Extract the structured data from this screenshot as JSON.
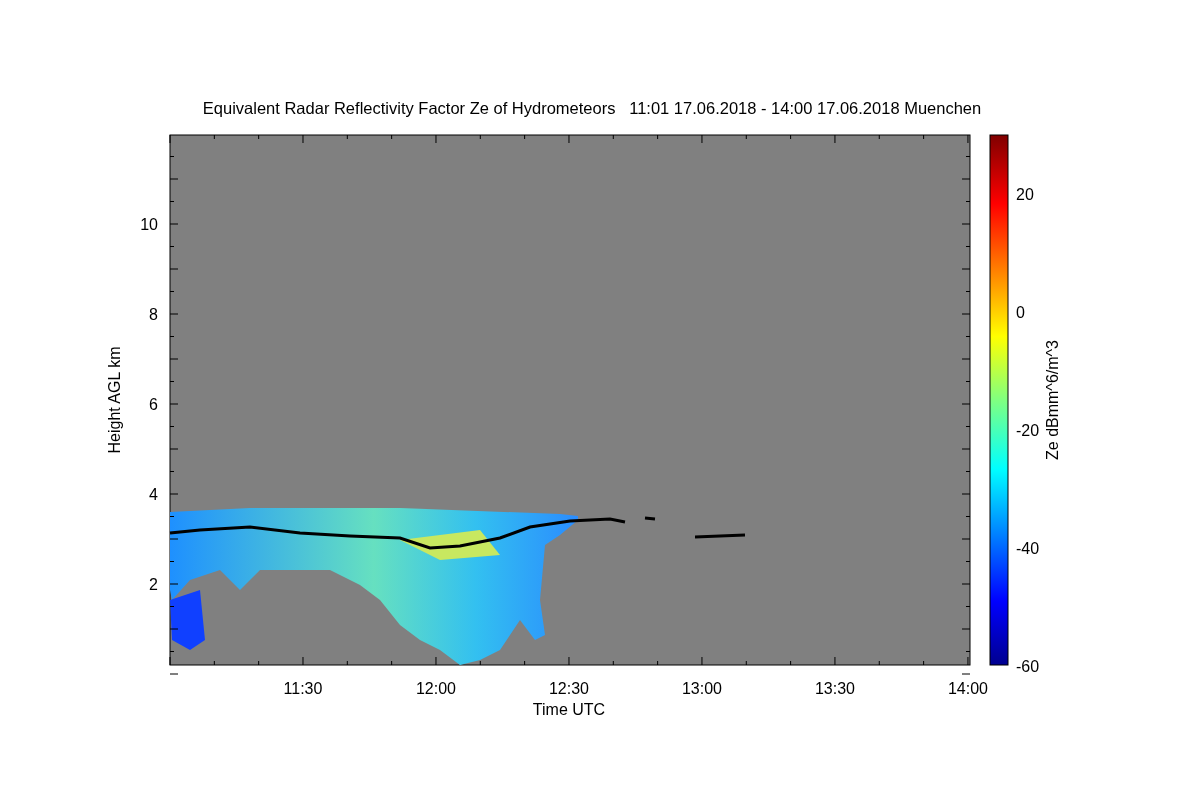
{
  "title": "Equivalent Radar Reflectivity Factor Ze of Hydrometeors   11:01 17.06.2018 - 14:00 17.06.2018 Muenchen",
  "y_axis": {
    "label": "Height AGL km",
    "ticks": [
      "10",
      "8",
      "6",
      "4",
      "2"
    ]
  },
  "x_axis": {
    "label": "Time UTC",
    "ticks": [
      "11:30",
      "12:00",
      "12:30",
      "13:00",
      "13:30",
      "14:00"
    ]
  },
  "colorbar": {
    "label": "Ze dBmm^6/m^3",
    "ticks": [
      "20",
      "0",
      "-20",
      "-40",
      "-60"
    ]
  }
}
